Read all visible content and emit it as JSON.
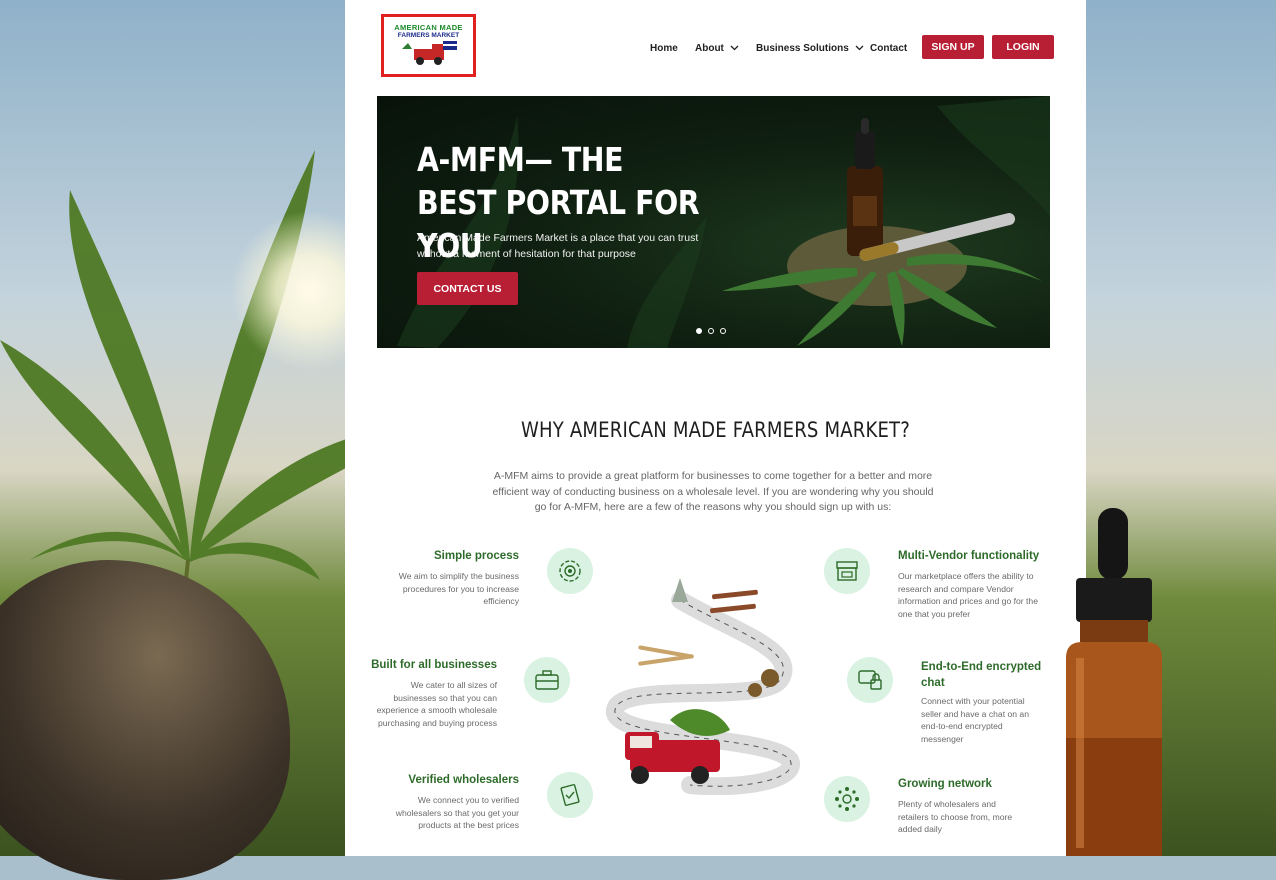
{
  "logo": {
    "line1": "AMERICAN MADE",
    "line2": "FARMERS MARKET"
  },
  "nav": {
    "home": "Home",
    "about": "About",
    "business": "Business Solutions",
    "contact": "Contact",
    "signup": "SIGN UP",
    "login": "LOGIN"
  },
  "hero": {
    "title": "A-MFM— THE BEST PORTAL FOR YOU",
    "subtitle": "American Made Farmers Market is a place that you can trust without a moment of hesitation for that purpose",
    "cta": "CONTACT US",
    "slides": 3,
    "active_slide": 1
  },
  "why": {
    "title": "WHY AMERICAN MADE FARMERS MARKET?",
    "text": "A-MFM aims to provide a great platform for businesses to come together for a better and more efficient way of conducting business on a wholesale level. If you are wondering why you should go for A-MFM, here are a few of the reasons why you should sign up with us:"
  },
  "features": {
    "simple": {
      "title": "Simple process",
      "desc": "We aim to simplify the business procedures for you to increase efficiency"
    },
    "built": {
      "title": "Built for all businesses",
      "desc": "We cater to all sizes of businesses so that you can experience a smooth wholesale purchasing and buying process"
    },
    "verified": {
      "title": "Verified wholesalers",
      "desc": "We connect you to verified wholesalers so that you get your products at the best prices"
    },
    "multi": {
      "title": "Multi-Vendor functionality",
      "desc": "Our marketplace offers the ability to research and compare Vendor information and prices and go for the one that you prefer"
    },
    "chat": {
      "title": "End-to-End encrypted chat",
      "desc": "Connect with your potential seller and have a chat on an end-to-end encrypted messenger"
    },
    "network": {
      "title": "Growing network",
      "desc": "Plenty of wholesalers and retailers to choose from, more added daily"
    }
  },
  "colors": {
    "brand_red": "#b81f35",
    "feature_green": "#2e6b2a",
    "icon_bg": "#d9f2e2"
  }
}
